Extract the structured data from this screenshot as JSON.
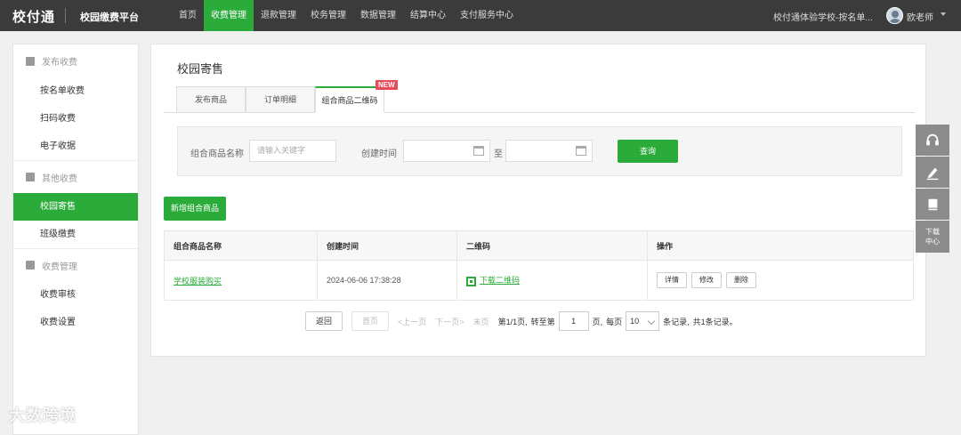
{
  "header": {
    "logo": "校付通",
    "platform": "校园缴费平台",
    "nav": [
      "首页",
      "收费管理",
      "退款管理",
      "校务管理",
      "数据管理",
      "结算中心",
      "支付服务中心"
    ],
    "active_nav": "收费管理",
    "school": "校付通体验学校-按名单...",
    "user": "欧老师"
  },
  "sidebar": {
    "groups": [
      {
        "title": "发布收费",
        "items": [
          "按名单收费",
          "扫码收费",
          "电子收据"
        ]
      },
      {
        "title": "其他收费",
        "items": [
          "校园寄售",
          "班级缴费"
        ]
      },
      {
        "title": "收费管理",
        "items": [
          "收费审核",
          "收费设置"
        ]
      }
    ],
    "active_item": "校园寄售"
  },
  "main": {
    "title": "校园寄售",
    "tabs": [
      "发布商品",
      "订单明细",
      "组合商品二维码"
    ],
    "active_tab": "组合商品二维码",
    "new_badge": "NEW",
    "filter": {
      "name_label": "组合商品名称",
      "name_placeholder": "请输入关键字",
      "time_label": "创建时间",
      "to_label": "至",
      "query_button": "查询"
    },
    "add_button": "新增组合商品",
    "table": {
      "columns": [
        "组合商品名称",
        "创建时间",
        "二维码",
        "操作"
      ],
      "rows": [
        {
          "name": "学校服装购买",
          "created": "2024-06-06 17:38:28",
          "qr": "下载二维码",
          "actions": [
            "详情",
            "修改",
            "删除"
          ]
        }
      ]
    },
    "pager": {
      "back": "返回",
      "first": "首页",
      "prev": "<上一页",
      "next": "下一页>",
      "last": "末页",
      "page_info": "第1/1页,",
      "goto_label": "转至第",
      "goto_value": "1",
      "page_unit": "页,",
      "per_page_label": "每页",
      "per_page": "10",
      "records_unit": "条记录,",
      "total": "共1条记录。"
    }
  },
  "float_bar": {
    "download_line1": "下载",
    "download_line2": "中心"
  },
  "watermark": "大数跨境",
  "colors": {
    "accent": "#2bab3a",
    "topbar": "#3b3b3b",
    "badge": "#e84a5a"
  }
}
